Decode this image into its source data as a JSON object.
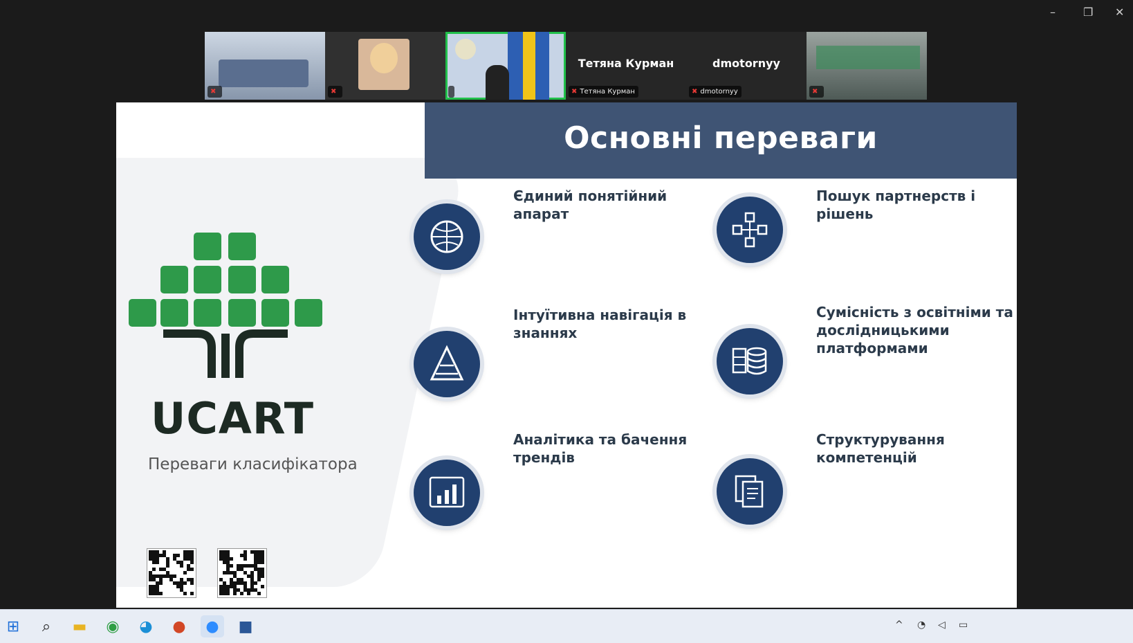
{
  "window": {
    "minimize": "–",
    "restore": "❐",
    "close": "✕"
  },
  "participants": [
    {
      "caption": "",
      "muted": true
    },
    {
      "caption": "",
      "muted": true
    },
    {
      "caption": "",
      "muted": false,
      "active": true
    },
    {
      "name": "Тетяна Курман",
      "caption": "Тетяна Курман",
      "muted": true
    },
    {
      "name": "dmotornyy",
      "caption": "dmotornyy",
      "muted": true
    },
    {
      "caption": "",
      "muted": true
    }
  ],
  "slide": {
    "title": "Основні переваги",
    "brand": "UCART",
    "subtitle": "Переваги класифікатора",
    "features": [
      {
        "title": "Єдиний понятійний апарат",
        "text": "",
        "icon": "globe-brain-icon"
      },
      {
        "title": "Пошук партнерств і рішень",
        "text": "",
        "icon": "network-cubes-icon"
      },
      {
        "title": "Інтуїтивна навігація в знаннях",
        "text": "",
        "icon": "pyramid-icon"
      },
      {
        "title": "Сумісність з освітніми та дослідницькими платформами",
        "text": "",
        "icon": "database-icon"
      },
      {
        "title": "Аналітика та бачення трендів",
        "text": "",
        "icon": "analytics-chart-icon"
      },
      {
        "title": "Структурування компетенцій",
        "text": "",
        "icon": "documents-icon"
      }
    ]
  },
  "taskbar": {
    "apps": [
      {
        "icon": "windows-start-icon",
        "glyph": "⊞",
        "color": "#1e6fd9"
      },
      {
        "icon": "search-icon",
        "glyph": "⌕",
        "color": "#222222"
      },
      {
        "icon": "file-explorer-icon",
        "glyph": "▬",
        "color": "#e8b423"
      },
      {
        "icon": "chrome-icon",
        "glyph": "◉",
        "color": "#2f9e44"
      },
      {
        "icon": "edge-icon",
        "glyph": "◕",
        "color": "#1b8fd6"
      },
      {
        "icon": "powerpoint-icon",
        "glyph": "●",
        "color": "#d24726"
      },
      {
        "icon": "zoom-icon",
        "glyph": "●",
        "color": "#2d8cff"
      },
      {
        "icon": "word-icon",
        "glyph": "■",
        "color": "#2b5797"
      }
    ],
    "tray": {
      "chevron": "^"
    }
  },
  "colors": {
    "accent_green": "#2e9a4a",
    "banner": "#3f5474",
    "icon_navy": "#21406f"
  }
}
